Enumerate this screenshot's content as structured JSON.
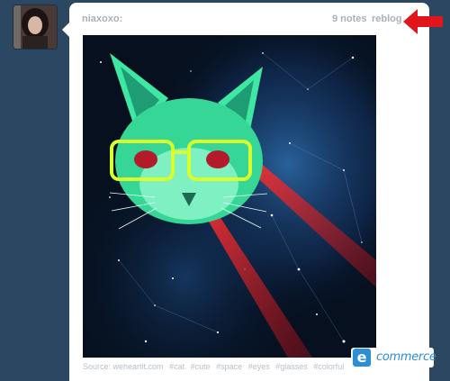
{
  "post": {
    "username": "niaxoxo:",
    "notes": "9 notes",
    "reblog": "reblog"
  },
  "photo": {
    "description_icon": "space-cat-laser-photo"
  },
  "caption": {
    "source_label": "Source: weheartit.com",
    "tags": [
      "#cat",
      "#cute",
      "#space",
      "#eyes",
      "#glasses",
      "#colorful"
    ]
  },
  "badge": {
    "mark": "e",
    "label": "commerce"
  },
  "colors": {
    "background": "#2c4762",
    "muted_text": "#a8b1ba",
    "arrow_red": "#e0161c",
    "cat_green": "#3ee8a2",
    "glasses_yellow": "#d8ff2a",
    "laser_red": "#c8102e",
    "badge_blue": "#2b8fd8"
  }
}
